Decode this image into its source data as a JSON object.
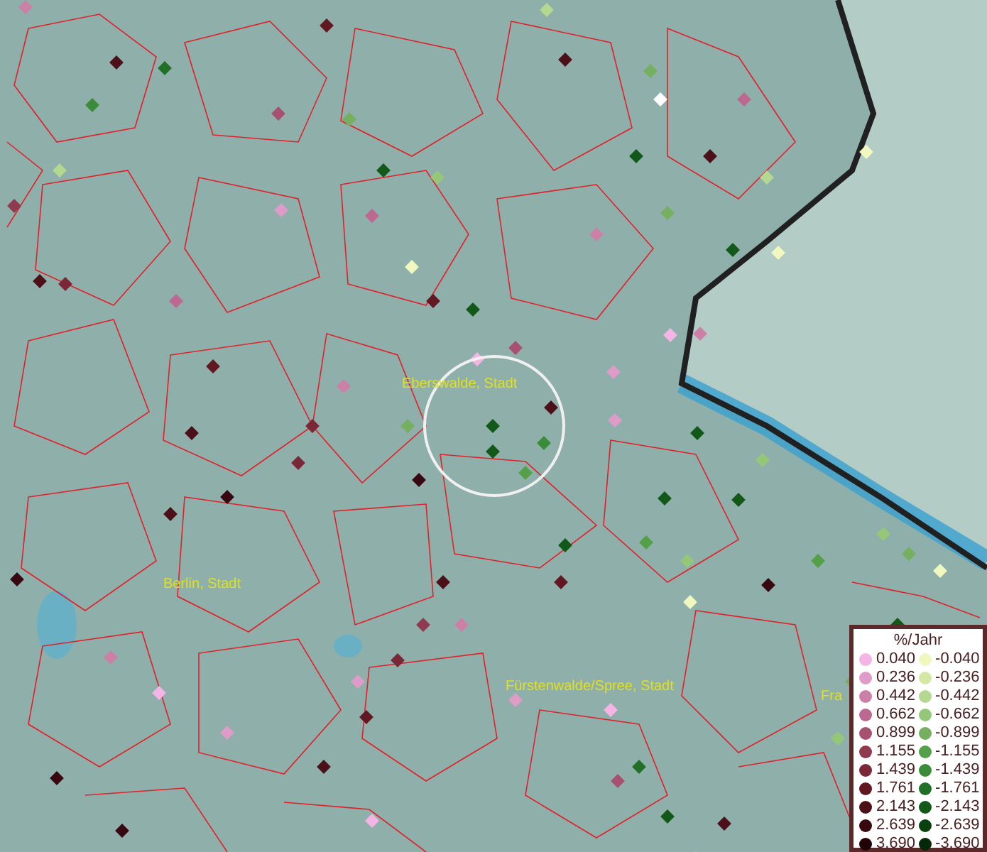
{
  "map": {
    "places": [
      {
        "name": "Eberswalde, Stadt"
      },
      {
        "name": "Berlin, Stadt"
      },
      {
        "name": "Fürstenwalde/Spree, Stadt"
      },
      {
        "name": "Fra"
      }
    ]
  },
  "legend": {
    "title": "%/Jahr",
    "positive": [
      {
        "label": "0.040",
        "color": "#f4b4e4"
      },
      {
        "label": "0.236",
        "color": "#e09cc8"
      },
      {
        "label": "0.442",
        "color": "#cc80a8"
      },
      {
        "label": "0.662",
        "color": "#bc6890"
      },
      {
        "label": "0.899",
        "color": "#a85070"
      },
      {
        "label": "1.155",
        "color": "#903a50"
      },
      {
        "label": "1.439",
        "color": "#7a2838"
      },
      {
        "label": "1.761",
        "color": "#621820"
      },
      {
        "label": "2.143",
        "color": "#4c1018"
      },
      {
        "label": "2.639",
        "color": "#380810"
      },
      {
        "label": "3.690",
        "color": "#200408"
      }
    ],
    "negative": [
      {
        "label": "-0.040",
        "color": "#f0f8c0"
      },
      {
        "label": "-0.236",
        "color": "#d4e8a4"
      },
      {
        "label": "-0.442",
        "color": "#b4d890"
      },
      {
        "label": "-0.662",
        "color": "#94c878"
      },
      {
        "label": "-0.899",
        "color": "#74b060"
      },
      {
        "label": "-1.155",
        "color": "#54a048"
      },
      {
        "label": "-1.439",
        "color": "#3a8c38"
      },
      {
        "label": "-1.761",
        "color": "#227028"
      },
      {
        "label": "-2.143",
        "color": "#125818"
      },
      {
        "label": "-2.639",
        "color": "#084010"
      },
      {
        "label": "-3.690",
        "color": "#042808"
      }
    ]
  }
}
